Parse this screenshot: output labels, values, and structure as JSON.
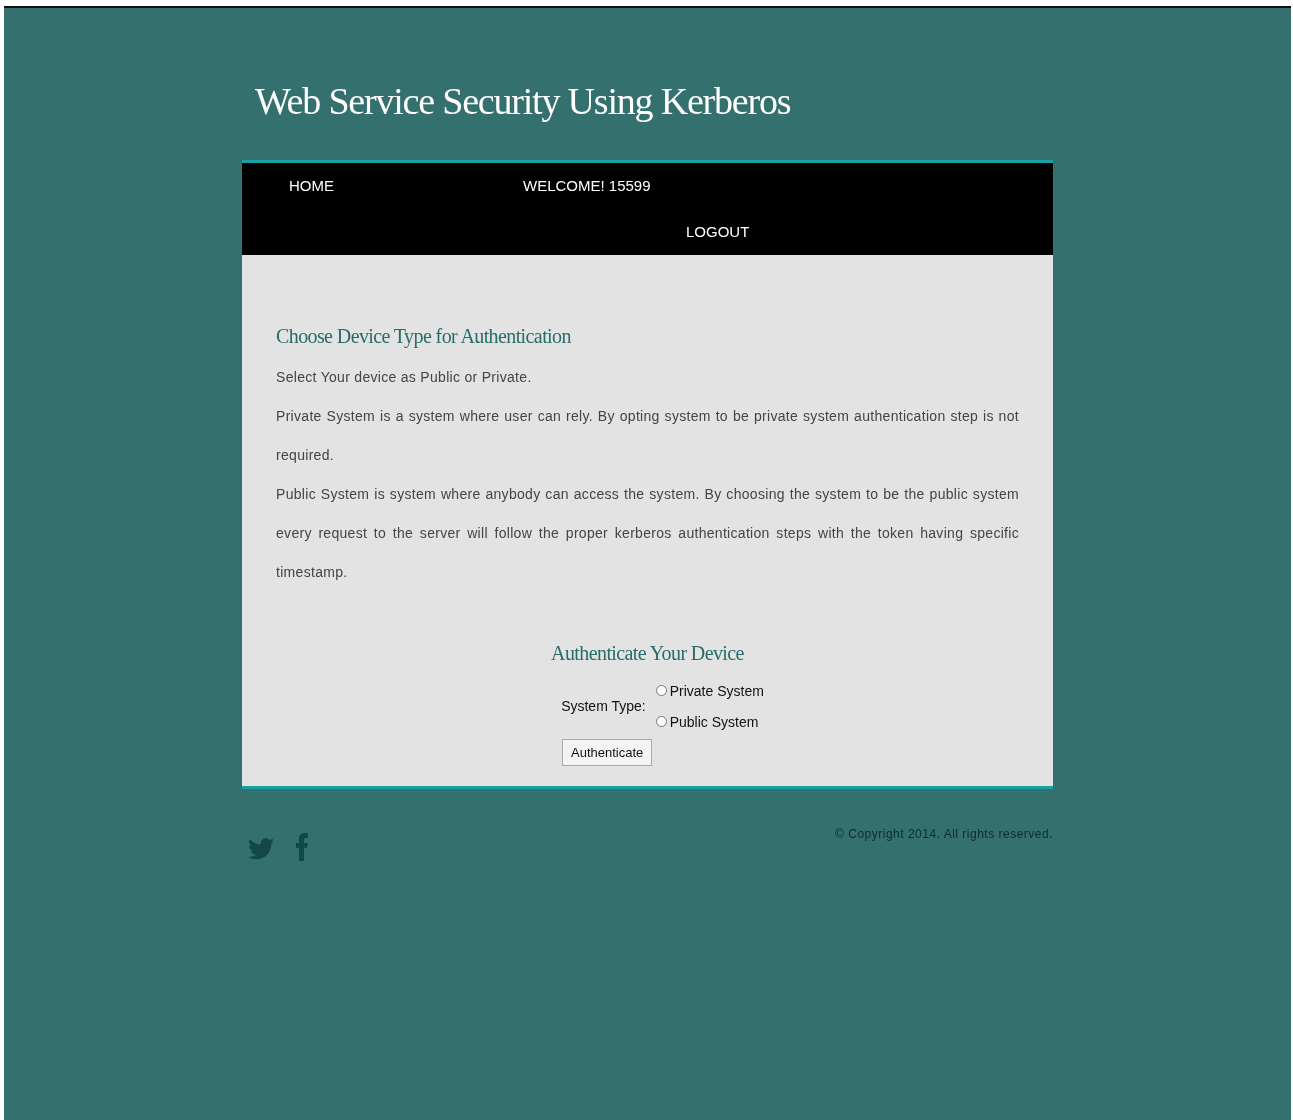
{
  "site_title": "Web Service Security Using Kerberos",
  "nav": {
    "items": [
      {
        "label": "HOME"
      },
      {
        "label": "WELCOME! 15599"
      },
      {
        "label": "LOGOUT"
      }
    ]
  },
  "content": {
    "heading": "Choose Device Type for Authentication",
    "paragraphs": [
      "Select Your device as Public or Private.",
      "Private System is a system where user can rely. By opting system to be private system authentication step is not required.",
      "Public System is system where anybody can access the system. By choosing the system to be the public system every request to the server will follow the proper kerberos authentication steps with the token having specific timestamp."
    ]
  },
  "form": {
    "heading": "Authenticate Your Device",
    "label": "System Type:",
    "options": [
      {
        "label": "Private System",
        "selected": false
      },
      {
        "label": "Public System",
        "selected": false
      }
    ],
    "button": "Authenticate"
  },
  "footer": {
    "copyright": "© Copyright 2014. All rights reserved."
  }
}
